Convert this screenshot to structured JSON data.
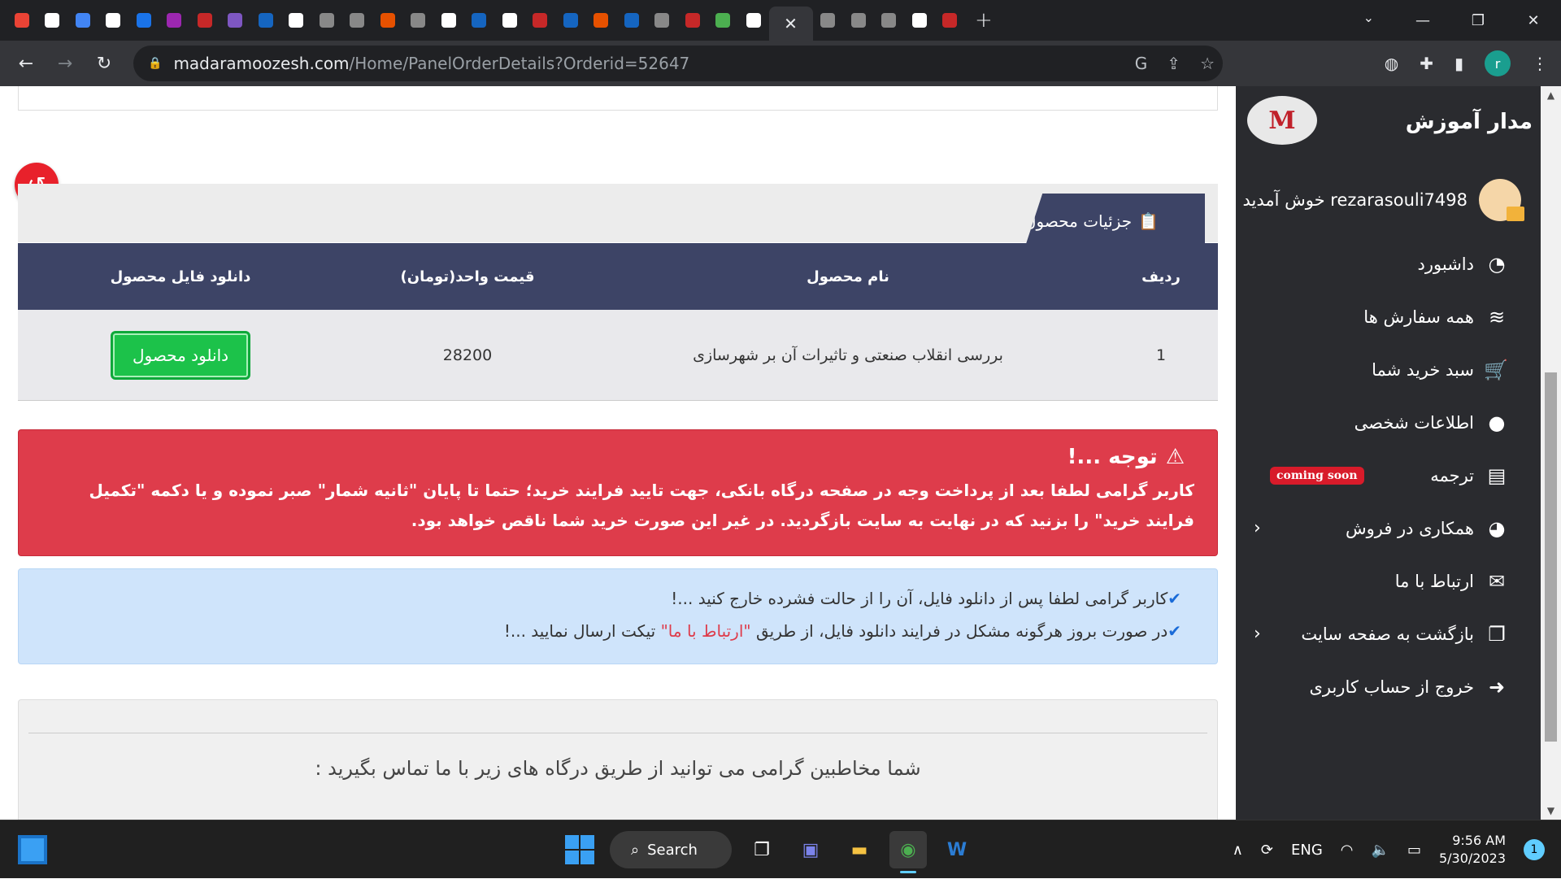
{
  "browser": {
    "tab_count_left": 25,
    "tab_count_right": 5,
    "active_tab_close": "✕",
    "new_tab": "+",
    "url_host": "madaramoozesh.com",
    "url_path": "/Home/PanelOrderDetails?Orderid=52647"
  },
  "page": {
    "section_title": "جزئیات محصول",
    "table": {
      "headers": [
        "ردیف",
        "نام محصول",
        "قیمت واحد(تومان)",
        "دانلود فایل محصول"
      ],
      "rows": [
        {
          "index": "1",
          "name": "بررسی انقلاب صنعتی و تاثیرات آن بر شهرسازی",
          "price": "28200",
          "download_label": "دانلود محصول"
        }
      ]
    },
    "alert": {
      "title": "توجه ...!",
      "body": "کاربر گرامی لطفا بعد از پرداخت وجه در صفحه درگاه بانکی، جهت تایید فرایند خرید؛ حتما تا پایان \"ثانیه شمار\" صبر نموده و یا دکمه \"تکمیل فرایند خرید\" را بزنید که در نهایت به سایت بازگردید. در غیر این صورت خرید شما ناقص خواهد بود."
    },
    "info": {
      "line1": "کاربر گرامی لطفا پس از دانلود فایل، آن را از حالت فشرده خارج کنید ...!",
      "line2_before": "در صورت بروز هرگونه مشکل در فرایند دانلود فایل، از طریق",
      "line2_link": "\"ارتباط با ما\"",
      "line2_after": "تیکت ارسال نمایید ...!"
    },
    "contact_text": "شما مخاطبین گرامی می توانید از طریق درگاه های زیر با ما تماس بگیرید :"
  },
  "sidebar": {
    "brand": "مدار آموزش",
    "logo_text": "M",
    "welcome": "rezarasouli7498 خوش آمدید",
    "items": [
      {
        "label": "داشبورد",
        "icon": "dashboard-icon",
        "glyph": "◔"
      },
      {
        "label": "همه سفارش ها",
        "icon": "layers-icon",
        "glyph": "≋"
      },
      {
        "label": "سبد خرید شما",
        "icon": "cart-icon",
        "glyph": "🛒"
      },
      {
        "label": "اطلاعات شخصی",
        "icon": "user-icon",
        "glyph": "●"
      },
      {
        "label": "ترجمه",
        "icon": "book-icon",
        "glyph": "▤",
        "badge": "coming soon"
      },
      {
        "label": "همکاری در فروش",
        "icon": "pie-chart-icon",
        "glyph": "◕",
        "chevron": true
      },
      {
        "label": "ارتباط با ما",
        "icon": "envelope-icon",
        "glyph": "✉"
      },
      {
        "label": "بازگشت به صفحه سایت",
        "icon": "copy-icon",
        "glyph": "❐",
        "chevron": true
      },
      {
        "label": "خروج از حساب کاربری",
        "icon": "sign-out-icon",
        "glyph": "➜"
      }
    ]
  },
  "taskbar": {
    "search_label": "Search",
    "language": "ENG",
    "time": "9:56 AM",
    "date": "5/30/2023",
    "notifications": "1"
  }
}
